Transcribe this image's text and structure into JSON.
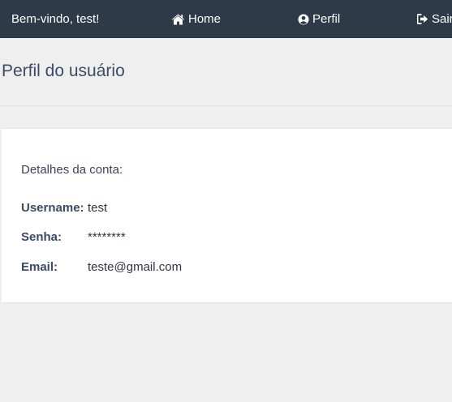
{
  "navbar": {
    "welcome": "Bem-vindo, test!",
    "home_label": "Home",
    "profile_label": "Perfil",
    "logout_label": "Sair"
  },
  "page": {
    "title": "Perfil do usuário"
  },
  "account": {
    "heading": "Detalhes da conta:",
    "fields": [
      {
        "label": "Username:",
        "value": "test"
      },
      {
        "label": "Senha:",
        "value": "********"
      },
      {
        "label": "Email:",
        "value": "teste@gmail.com"
      }
    ]
  },
  "colors": {
    "navbar_bg": "#2e3a48",
    "page_bg": "#efefef",
    "card_bg": "#ffffff",
    "title_color": "#3c4b66"
  },
  "icons": {
    "home": "home-icon",
    "profile": "user-circle-icon",
    "logout": "sign-out-icon"
  }
}
